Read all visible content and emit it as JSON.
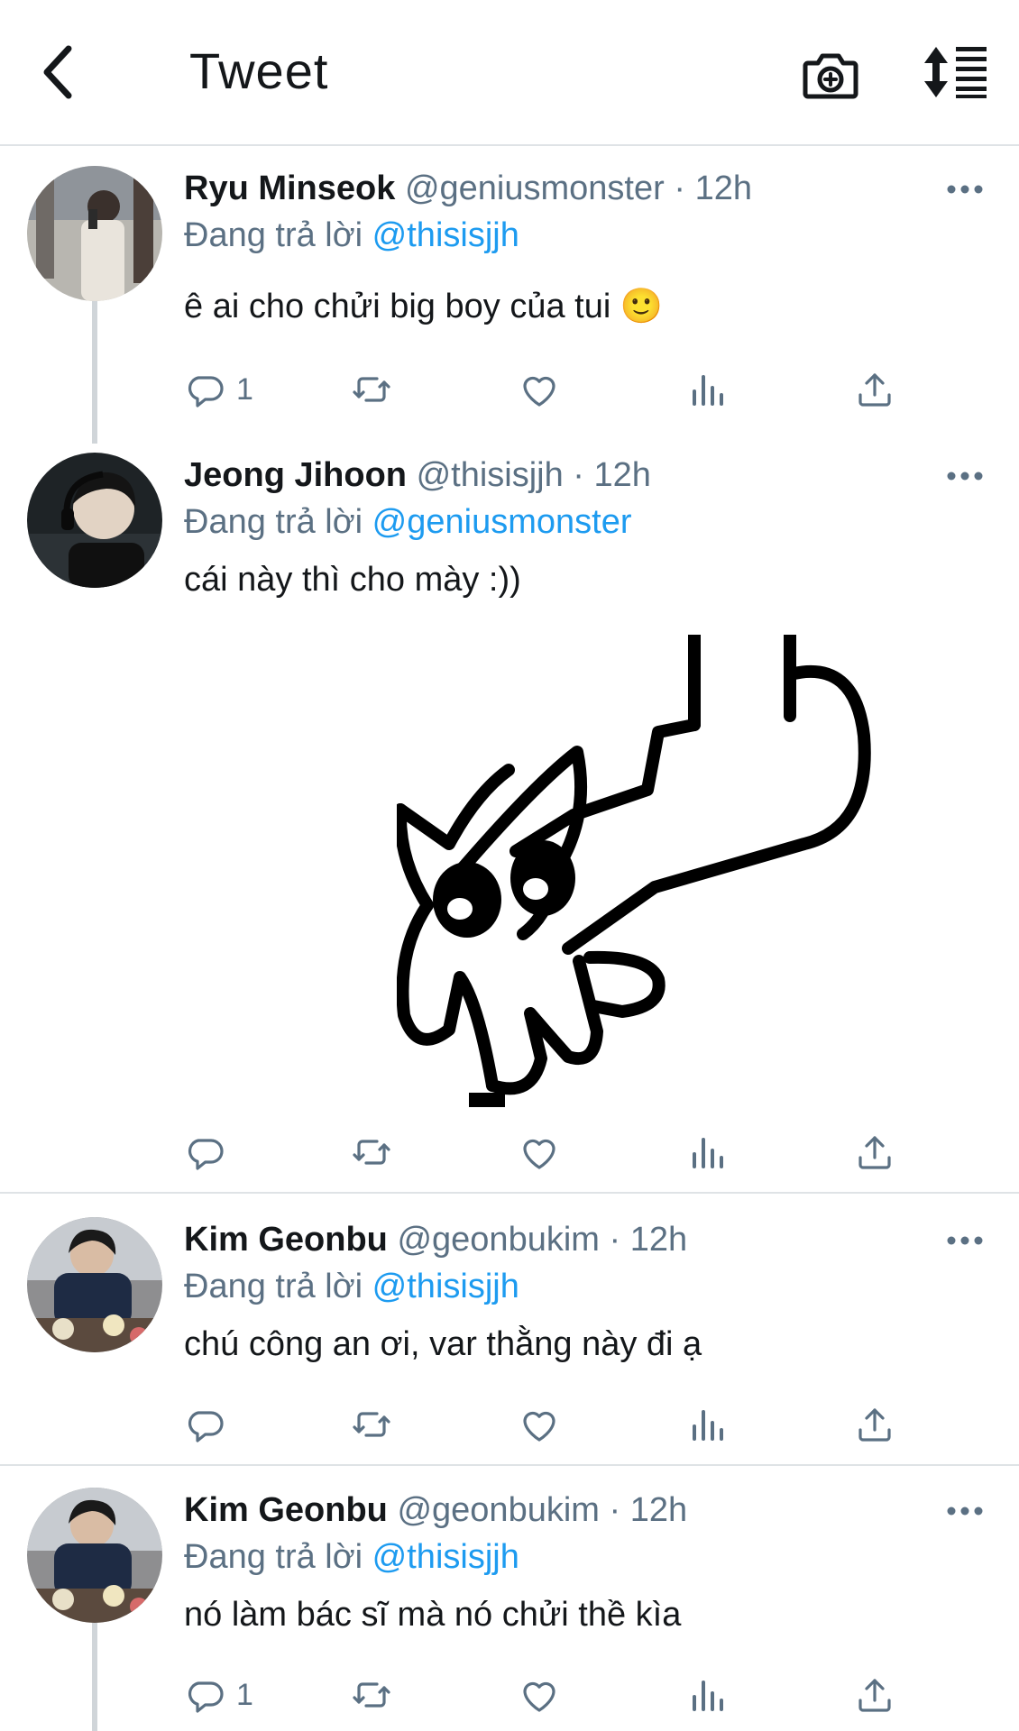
{
  "header": {
    "title": "Tweet",
    "back_icon": "chevron-left-icon",
    "camera_icon": "camera-plus-icon",
    "sort_icon": "sort-icon"
  },
  "tweets": [
    {
      "name": "Ryu Minseok",
      "handle": "@geniusmonster",
      "separator": "·",
      "time": "12h",
      "replying_prefix": "Đang trả lời",
      "replying_to": "@thisisjjh",
      "text": "ê ai cho chửi big boy của tui 🙂",
      "reply_count": "1"
    },
    {
      "name": "Jeong Jihoon",
      "handle": "@thisisjjh",
      "separator": "·",
      "time": "12h",
      "replying_prefix": "Đang trả lời",
      "replying_to": "@geniusmonster",
      "text": "cái này thì cho mày :))",
      "reply_count": ""
    },
    {
      "name": "Kim Geonbu",
      "handle": "@geonbukim",
      "separator": "·",
      "time": "12h",
      "replying_prefix": "Đang trả lời",
      "replying_to": "@thisisjjh",
      "text": "chú công an ơi, var thằng này đi ạ",
      "reply_count": ""
    },
    {
      "name": "Kim Geonbu",
      "handle": "@geonbukim",
      "separator": "·",
      "time": "12h",
      "replying_prefix": "Đang trả lời",
      "replying_to": "@thisisjjh",
      "text": "nó làm bác sĩ mà nó chửi thề kìa",
      "reply_count": "1"
    }
  ],
  "colors": {
    "link": "#1d9bf0",
    "secondary": "#5b7083",
    "text": "#14171a",
    "divider": "#dfe3e6"
  }
}
